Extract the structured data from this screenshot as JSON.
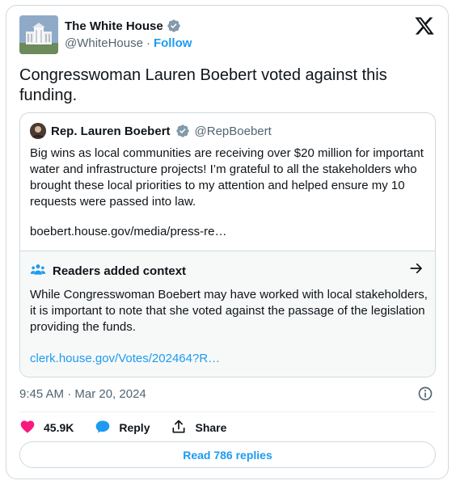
{
  "author": {
    "display_name": "The White House",
    "handle": "@WhiteHouse",
    "separator": "·",
    "follow_label": "Follow"
  },
  "tweet": {
    "text": "Congresswoman Lauren Boebert voted against this funding.",
    "timestamp": "9:45 AM · Mar 20, 2024"
  },
  "quoted": {
    "display_name": "Rep. Lauren Boebert",
    "handle": "@RepBoebert",
    "text": "Big wins as local communities are receiving over $20 million for important water and infrastructure projects! I’m grateful to all the stakeholders who brought these local priorities to my attention and helped ensure my 10 requests were passed into law.",
    "link": "boebert.house.gov/media/press-re…"
  },
  "context": {
    "title": "Readers added context",
    "text": "While Congresswoman Boebert may have worked with local stakeholders, it is important to note that she voted against the passage of the legislation providing the funds.",
    "link": "clerk.house.gov/Votes/202464?R…"
  },
  "actions": {
    "likes": "45.9K",
    "reply_label": "Reply",
    "share_label": "Share"
  },
  "replies_button": "Read 786 replies",
  "colors": {
    "accent": "#1d9bf0",
    "like": "#f91880",
    "text": "#0f1419",
    "muted": "#536471",
    "border": "#cfd9de"
  },
  "icons": [
    "verified-badge-icon",
    "x-logo-icon",
    "readers-icon",
    "arrow-right-icon",
    "info-icon",
    "heart-icon",
    "reply-icon",
    "share-icon"
  ]
}
